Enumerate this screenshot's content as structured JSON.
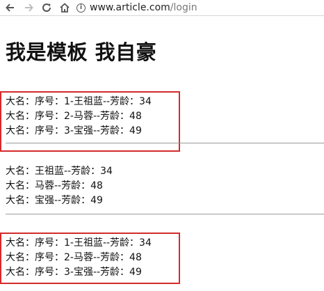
{
  "browser": {
    "url_host": "www.article.com",
    "url_path": "/login",
    "info_icon": "info-icon",
    "icons": [
      "back-arrow-icon",
      "forward-arrow-icon",
      "reload-icon",
      "home-icon"
    ]
  },
  "page": {
    "title": "我是模板 我自豪",
    "section1": [
      "大名：序号：1-王祖蓝--芳龄：34",
      "大名：序号：2-马蓉--芳龄：48",
      "大名：序号：3-宝强--芳龄：49"
    ],
    "section2": [
      "大名：王祖蓝--芳龄：34",
      "大名：马蓉--芳龄：48",
      "大名：宝强--芳龄：49"
    ],
    "section3": [
      "大名：序号：1-王祖蓝--芳龄：34",
      "大名：序号：2-马蓉--芳龄：48",
      "大名：序号：3-宝强--芳龄：49"
    ]
  },
  "colors": {
    "highlight_box": "#d42b2b",
    "rule": "#9a9a9a",
    "text": "#111111"
  }
}
